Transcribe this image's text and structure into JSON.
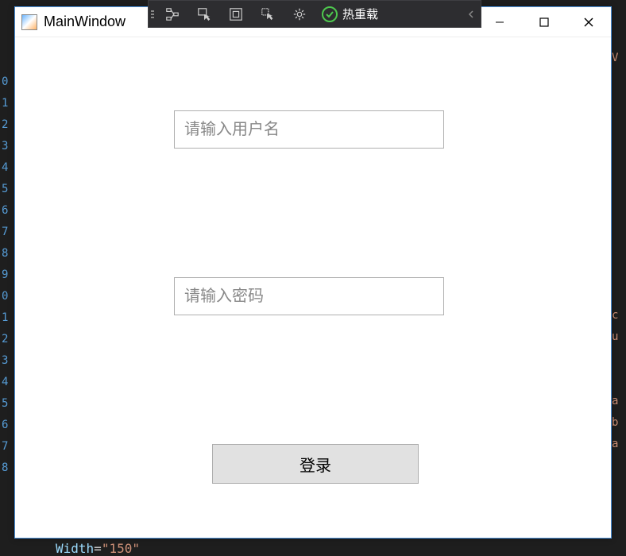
{
  "window": {
    "title": "MainWindow"
  },
  "debug_toolbar": {
    "hot_reload_label": "热重载"
  },
  "form": {
    "username_placeholder": "请输入用户名",
    "password_placeholder": "请输入密码",
    "login_button_label": "登录"
  },
  "bg": {
    "bottom_code_attr": "Width",
    "bottom_code_eq": "=",
    "bottom_code_val": "\"150\""
  }
}
